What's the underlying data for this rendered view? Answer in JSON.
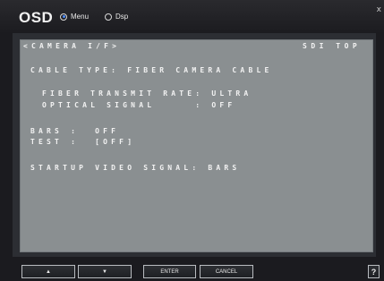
{
  "window": {
    "title": "OSD",
    "close_glyph": "x"
  },
  "mode": {
    "menu_label": "Menu",
    "dsp_label": "Dsp",
    "selected": "Menu"
  },
  "osd": {
    "header_left": "<CAMERA I/F>",
    "header_right": "SDI TOP",
    "cable_type": "CABLE TYPE: FIBER CAMERA CABLE",
    "fiber_rate": "FIBER TRANSMIT RATE: ULTRA",
    "optical_signal": "OPTICAL SIGNAL     : OFF",
    "bars": "BARS :  OFF",
    "test": "TEST :  [OFF]",
    "startup": "STARTUP VIDEO SIGNAL: BARS"
  },
  "buttons": {
    "up": "▲",
    "down": "▼",
    "enter": "ENTER",
    "cancel": "CANCEL",
    "help": "?"
  },
  "colors": {
    "screen_bg": "#8a8f91",
    "accent_radio": "#4a8bff"
  }
}
